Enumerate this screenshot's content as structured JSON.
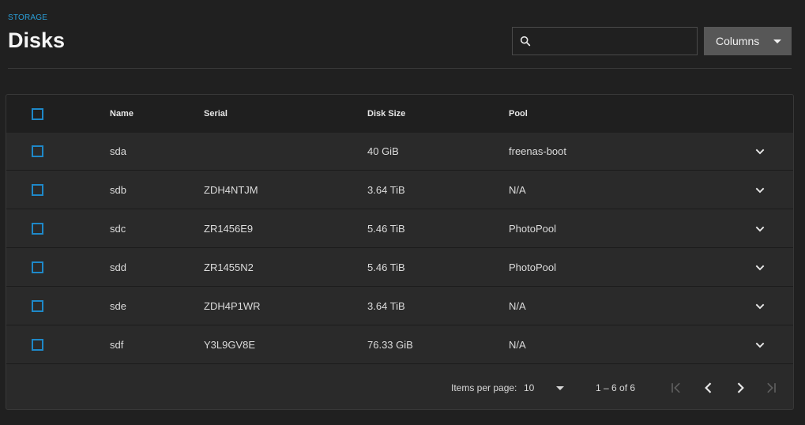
{
  "breadcrumb": "STORAGE",
  "title": "Disks",
  "search": {
    "placeholder": "",
    "value": ""
  },
  "columns_button": "Columns",
  "table": {
    "headers": {
      "name": "Name",
      "serial": "Serial",
      "size": "Disk Size",
      "pool": "Pool"
    },
    "rows": [
      {
        "name": "sda",
        "serial": "",
        "size": "40 GiB",
        "pool": "freenas-boot"
      },
      {
        "name": "sdb",
        "serial": "ZDH4NTJM",
        "size": "3.64 TiB",
        "pool": "N/A"
      },
      {
        "name": "sdc",
        "serial": "ZR1456E9",
        "size": "5.46 TiB",
        "pool": "PhotoPool"
      },
      {
        "name": "sdd",
        "serial": "ZR1455N2",
        "size": "5.46 TiB",
        "pool": "PhotoPool"
      },
      {
        "name": "sde",
        "serial": "ZDH4P1WR",
        "size": "3.64 TiB",
        "pool": "N/A"
      },
      {
        "name": "sdf",
        "serial": "Y3L9GV8E",
        "size": "76.33 GiB",
        "pool": "N/A"
      }
    ]
  },
  "paginator": {
    "items_per_page_label": "Items per page:",
    "items_per_page": "10",
    "range": "1 – 6 of 6"
  },
  "colors": {
    "accent": "#1e88c8",
    "background": "#202020",
    "card": "#2a2a2a"
  }
}
